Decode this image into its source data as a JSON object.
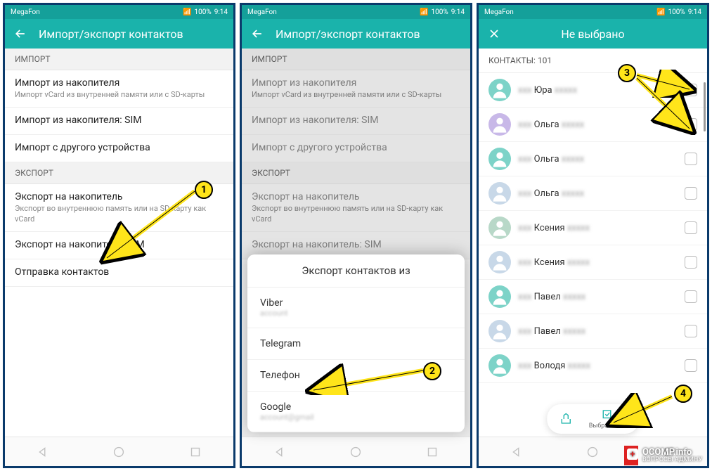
{
  "status": {
    "carrier": "MegaFon",
    "battery": "100%",
    "time": "9:14"
  },
  "screen1": {
    "title": "Импорт/экспорт контактов",
    "sec_import": "ИМПОРТ",
    "sec_export": "ЭКСПОРТ",
    "items": {
      "imp_storage": "Импорт из накопителя",
      "imp_storage_sub": "Импорт vCard из внутренней памяти или с SD-карты",
      "imp_sim": "Импорт из накопителя: SIM",
      "imp_device": "Импорт с другого устройства",
      "exp_storage": "Экспорт на накопитель",
      "exp_storage_sub": "Экспорт во внутреннюю память или на SD-карту как vCard",
      "exp_sim": "Экспорт на накопитель: SIM",
      "send": "Отправка контактов"
    }
  },
  "screen2": {
    "sheet_title": "Экспорт контактов из",
    "options": [
      "Viber",
      "Telegram",
      "Телефон",
      "Google"
    ]
  },
  "screen3": {
    "title": "Не выбрано",
    "header": "КОНТАКТЫ: 101",
    "contacts": [
      "Юра",
      "Ольга",
      "Ольга",
      "Ольга",
      "Ксения",
      "Ксения",
      "Павел",
      "Павел",
      "Володя"
    ],
    "select_all": "Выбрать все"
  },
  "annotations": {
    "b1": "1",
    "b2": "2",
    "b3": "3",
    "b4": "4"
  },
  "watermark": {
    "main": "OCOMP.info",
    "sub": "ВОПРОСЫ АДМИНУ"
  }
}
